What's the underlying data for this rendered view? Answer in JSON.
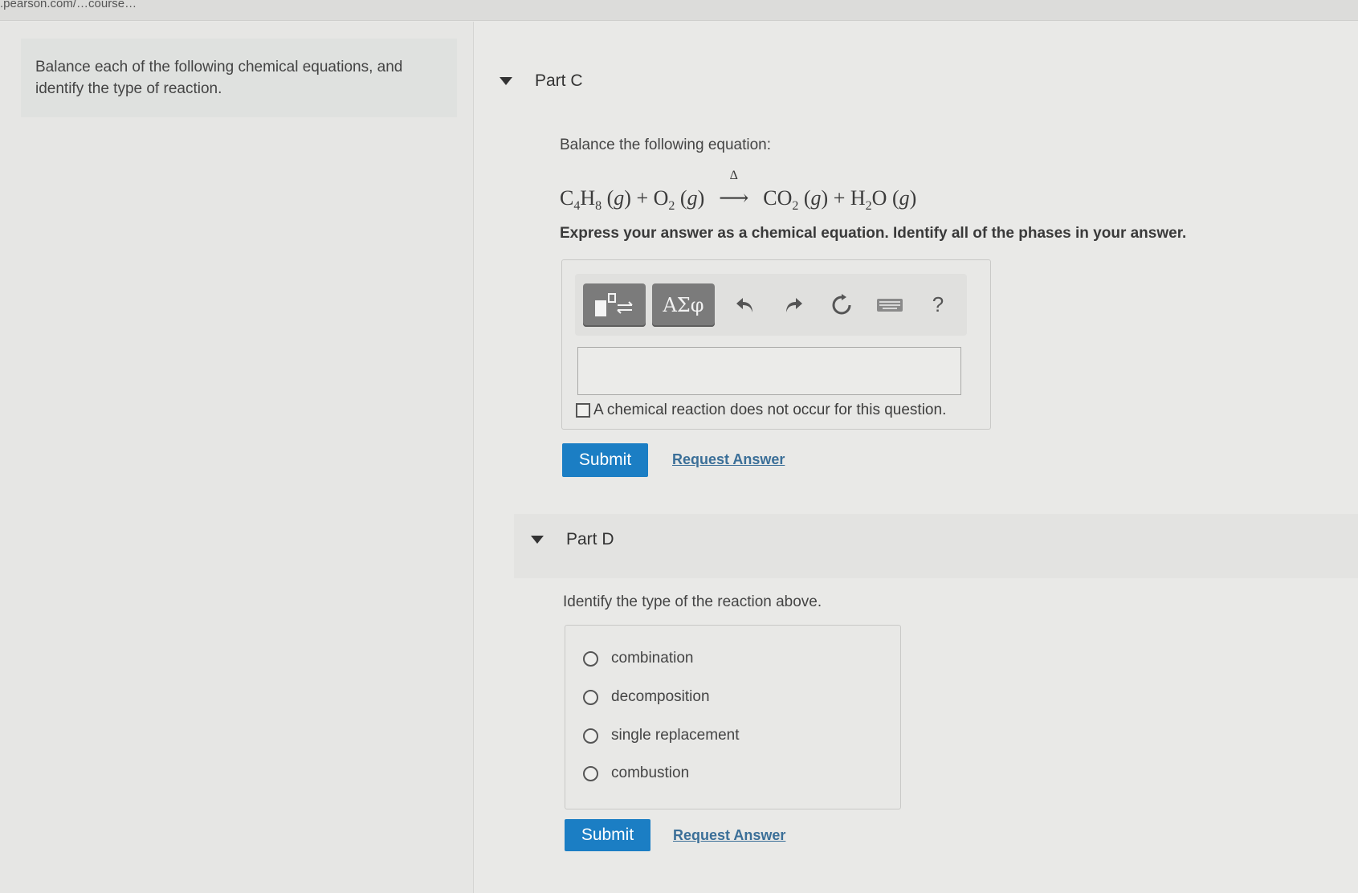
{
  "browser": {
    "url_fragment": ".pearson.com/…course…"
  },
  "intro": {
    "text": "Balance each of the following chemical equations, and identify the type of reaction."
  },
  "part_c": {
    "title": "Part C",
    "prompt": "Balance the following equation:",
    "equation": {
      "r1": "C",
      "r1_sub1": "4",
      "r1_mid": "H",
      "r1_sub2": "8",
      "r1_phase": "g",
      "r2": "O",
      "r2_sub": "2",
      "r2_phase": "g",
      "condition": "Δ",
      "p1": "CO",
      "p1_sub": "2",
      "p1_phase": "g",
      "p2": "H",
      "p2_sub": "2",
      "p2_end": "O",
      "p2_phase": "g"
    },
    "instructions": "Express your answer as a chemical equation. Identify all of the phases in your answer.",
    "toolbar": {
      "templates_icon": "templates-icon",
      "greek_label": "ΑΣφ",
      "undo_icon": "undo-icon",
      "redo_icon": "redo-icon",
      "reset_icon": "reset-icon",
      "keyboard_icon": "keyboard-icon",
      "help_label": "?"
    },
    "answer_value": "",
    "no_reaction_label": "A chemical reaction does not occur for this question.",
    "submit_label": "Submit",
    "request_answer_label": "Request Answer"
  },
  "part_d": {
    "title": "Part D",
    "prompt": "Identify the type of the reaction above.",
    "options": [
      "combination",
      "decomposition",
      "single replacement",
      "combustion"
    ],
    "submit_label": "Submit",
    "request_answer_label": "Request Answer"
  },
  "colors": {
    "submit": "#1b7ec4",
    "link": "#3b6f98",
    "toolbar_button": "#7b7b7b"
  }
}
